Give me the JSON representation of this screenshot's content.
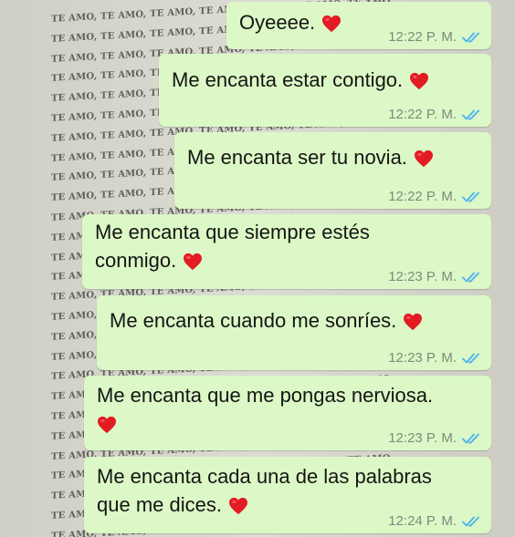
{
  "background": {
    "repeated_text": "TE AMO, TE AMO, TE AMO, TE AMO, TE AMO, TE AMO, TE AMO,"
  },
  "chat": {
    "bubble_color": "#dcf8c6",
    "read_tick_color": "#4fb4f0",
    "messages": [
      {
        "text": "Oyeeee.",
        "emoji": "red-heart-icon",
        "time": "12:22 P. M.",
        "status": "read"
      },
      {
        "text": "Me encanta estar contigo.",
        "emoji": "red-heart-icon",
        "time": "12:22 P. M.",
        "status": "read"
      },
      {
        "text": "Me encanta ser tu novia.",
        "emoji": "red-heart-icon",
        "time": "12:22 P. M.",
        "status": "read"
      },
      {
        "text": "Me encanta que siempre estés\nconmigo.",
        "emoji": "red-heart-icon",
        "time": "12:23 P. M.",
        "status": "read"
      },
      {
        "text": "Me encanta cuando me sonríes.",
        "emoji": "red-heart-icon",
        "time": "12:23 P. M.",
        "status": "read"
      },
      {
        "text": "Me encanta que me pongas nerviosa.\n",
        "emoji": "red-heart-icon",
        "time": "12:23 P. M.",
        "status": "read"
      },
      {
        "text": "Me encanta cada una de las palabras\nque me dices.",
        "emoji": "red-heart-icon",
        "time": "12:24 P. M.",
        "status": "read"
      }
    ]
  }
}
